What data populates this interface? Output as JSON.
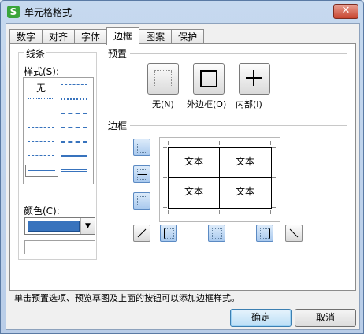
{
  "window": {
    "title": "单元格格式",
    "app_icon": "S",
    "close_glyph": "✕"
  },
  "tabs": [
    {
      "label": "数字"
    },
    {
      "label": "对齐"
    },
    {
      "label": "字体"
    },
    {
      "label": "边框",
      "active": true
    },
    {
      "label": "图案"
    },
    {
      "label": "保护"
    }
  ],
  "line": {
    "group_label": "线条",
    "style_label": "样式(S):",
    "none_label": "无",
    "color_label": "颜色(C):",
    "selected_color": "#3873bd"
  },
  "presets": {
    "group_label": "预置",
    "items": [
      {
        "label": "无(N)",
        "icon": "border-none-icon"
      },
      {
        "label": "外边框(O)",
        "icon": "border-outline-icon"
      },
      {
        "label": "内部(I)",
        "icon": "border-inside-icon"
      }
    ]
  },
  "border": {
    "group_label": "边框",
    "cells": [
      "文本",
      "文本",
      "文本",
      "文本"
    ]
  },
  "hint": "单击预置选项、预览草图及上面的按钮可以添加边框样式。",
  "buttons": {
    "ok": "确定",
    "cancel": "取消"
  }
}
